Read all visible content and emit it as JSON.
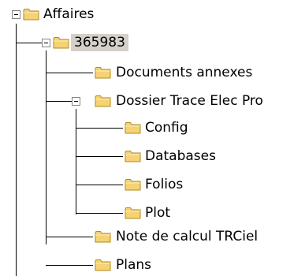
{
  "tree": {
    "root": {
      "label": "Affaires",
      "expanded": true,
      "children": [
        {
          "label": "365983",
          "selected": true,
          "expanded": true,
          "children": [
            {
              "label": "Documents annexes"
            },
            {
              "label": "Dossier Trace Elec Pro",
              "expanded": true,
              "children": [
                {
                  "label": "Config"
                },
                {
                  "label": "Databases"
                },
                {
                  "label": "Folios"
                },
                {
                  "label": "Plot"
                }
              ]
            },
            {
              "label": "Note de calcul TRCiel"
            },
            {
              "label": "Plans"
            }
          ]
        }
      ]
    }
  },
  "icons": {
    "expander": "minus-box-icon",
    "folder": "folder-closed-icon"
  },
  "colors": {
    "folder_fill": "#f5d373",
    "folder_stroke": "#b38a1e",
    "selection": "#d4d0c8",
    "expander_border": "#848484"
  }
}
